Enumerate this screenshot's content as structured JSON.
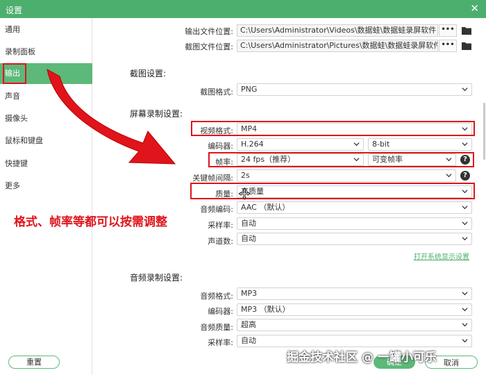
{
  "window": {
    "title": "设置",
    "close_glyph": "✕"
  },
  "sidebar": {
    "items": [
      {
        "label": "通用"
      },
      {
        "label": "录制面板"
      },
      {
        "label": "输出"
      },
      {
        "label": "声音"
      },
      {
        "label": "摄像头"
      },
      {
        "label": "鼠标和键盘"
      },
      {
        "label": "快捷键"
      },
      {
        "label": "更多"
      }
    ],
    "active_index": 2
  },
  "output": {
    "output_folder_label": "输出文件位置:",
    "output_folder_value": "C:\\Users\\Administrator\\Videos\\数据蛙\\数据蛙录屏软件",
    "screenshot_folder_label": "截图文件位置:",
    "screenshot_folder_value": "C:\\Users\\Administrator\\Pictures\\数据蛙\\数据蛙录屏软件",
    "browse_label": "•••"
  },
  "screenshot": {
    "section_title": "截图设置:",
    "format_label": "截图格式:",
    "format_value": "PNG"
  },
  "recording": {
    "section_title": "屏幕录制设置:",
    "video_format_label": "视频格式:",
    "video_format_value": "MP4",
    "encoder_label": "编码器:",
    "encoder_value": "H.264",
    "bit_depth_value": "8-bit",
    "framerate_label": "帧率:",
    "framerate_value": "24 fps（推荐）",
    "framerate_mode_value": "可变帧率",
    "keyframe_label": "关键帧间隔:",
    "keyframe_value": "2s",
    "quality_label": "质量:",
    "quality_value": "高质量",
    "audio_codec_label": "音频编码:",
    "audio_codec_value": "AAC （默认）",
    "sample_rate_label": "采样率:",
    "sample_rate_value": "自动",
    "channels_label": "声道数:",
    "channels_value": "自动",
    "system_display_link": "打开系统显示设置"
  },
  "audio": {
    "section_title": "音频录制设置:",
    "format_label": "音频格式:",
    "format_value": "MP3",
    "encoder_label": "编码器:",
    "encoder_value": "MP3 （默认）",
    "quality_label": "音频质量:",
    "quality_value": "超高",
    "sample_rate_label": "采样率:",
    "sample_rate_value": "自动"
  },
  "footer": {
    "reset_label": "重置",
    "ok_label": "确定",
    "cancel_label": "取消"
  },
  "annotation": {
    "text": "格式、帧率等都可以按需调整"
  },
  "watermark": {
    "text": "掘金技术社区 @ 一罐小可乐"
  },
  "colors": {
    "accent": "#5cb97a",
    "titlebar": "#4caf6e",
    "annotation_red": "#e0141b"
  }
}
